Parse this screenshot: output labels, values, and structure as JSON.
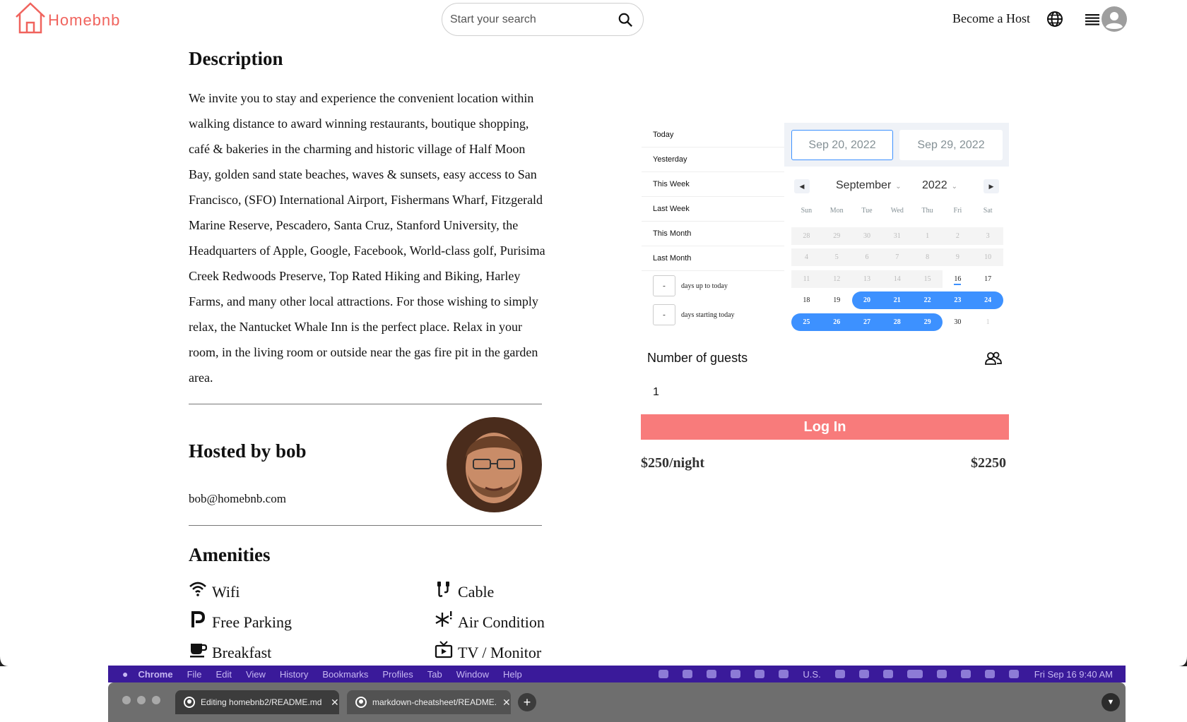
{
  "header": {
    "logo_text": "Homebnb",
    "search_placeholder": "Start your search",
    "become_host": "Become a Host"
  },
  "description": {
    "title": "Description",
    "text": "We invite you to stay and experience the convenient location within walking distance to award winning restaurants, boutique shopping, café & bakeries in the charming and historic village of Half Moon Bay, golden sand state beaches, waves & sunsets, easy access to San Francisco, (SFO) International Airport, Fishermans Wharf, Fitzgerald Marine Reserve, Pescadero, Santa Cruz, Stanford University, the Headquarters of Apple, Google, Facebook, World-class golf, Purisima Creek Redwoods Preserve, Top Rated Hiking and Biking, Harley Farms, and many other local attractions. For those wishing to simply relax, the Nantucket Whale Inn is the perfect place. Relax in your room, in the living room or outside near the gas fire pit in the garden area."
  },
  "host": {
    "title": "Hosted by bob",
    "email": "bob@homebnb.com"
  },
  "amenities": {
    "title": "Amenities",
    "items": [
      {
        "label": "Wifi",
        "icon": "wifi-icon"
      },
      {
        "label": "Cable",
        "icon": "cable-icon"
      },
      {
        "label": "Free Parking",
        "icon": "parking-icon"
      },
      {
        "label": "Air Condition",
        "icon": "snowflake-icon"
      },
      {
        "label": "Breakfast",
        "icon": "coffee-icon"
      },
      {
        "label": "TV / Monitor",
        "icon": "tv-icon"
      }
    ]
  },
  "picker": {
    "ranges": [
      "Today",
      "Yesterday",
      "This Week",
      "Last Week",
      "This Month",
      "Last Month"
    ],
    "input_ranges": [
      {
        "value": "-",
        "label": "days up to today"
      },
      {
        "value": "-",
        "label": "days starting today"
      }
    ],
    "start_date": "Sep 20, 2022",
    "end_date": "Sep 29, 2022",
    "month": "September",
    "year": "2022",
    "weekdays": [
      "Sun",
      "Mon",
      "Tue",
      "Wed",
      "Thu",
      "Fri",
      "Sat"
    ],
    "weeks": [
      [
        {
          "d": "28",
          "s": "dis"
        },
        {
          "d": "29",
          "s": "dis"
        },
        {
          "d": "30",
          "s": "dis"
        },
        {
          "d": "31",
          "s": "dis"
        },
        {
          "d": "1",
          "s": "dis"
        },
        {
          "d": "2",
          "s": "dis"
        },
        {
          "d": "3",
          "s": "dis"
        }
      ],
      [
        {
          "d": "4",
          "s": "dis"
        },
        {
          "d": "5",
          "s": "dis"
        },
        {
          "d": "6",
          "s": "dis"
        },
        {
          "d": "7",
          "s": "dis"
        },
        {
          "d": "8",
          "s": "dis"
        },
        {
          "d": "9",
          "s": "dis"
        },
        {
          "d": "10",
          "s": "dis"
        }
      ],
      [
        {
          "d": "11",
          "s": "dis"
        },
        {
          "d": "12",
          "s": "dis"
        },
        {
          "d": "13",
          "s": "dis"
        },
        {
          "d": "14",
          "s": "dis"
        },
        {
          "d": "15",
          "s": "dis"
        },
        {
          "d": "16",
          "s": "today"
        },
        {
          "d": "17",
          "s": ""
        }
      ],
      [
        {
          "d": "18",
          "s": ""
        },
        {
          "d": "19",
          "s": ""
        },
        {
          "d": "20",
          "s": "sel first"
        },
        {
          "d": "21",
          "s": "sel"
        },
        {
          "d": "22",
          "s": "sel"
        },
        {
          "d": "23",
          "s": "sel"
        },
        {
          "d": "24",
          "s": "sel last"
        }
      ],
      [
        {
          "d": "25",
          "s": "sel first"
        },
        {
          "d": "26",
          "s": "sel"
        },
        {
          "d": "27",
          "s": "sel"
        },
        {
          "d": "28",
          "s": "sel"
        },
        {
          "d": "29",
          "s": "sel last"
        },
        {
          "d": "30",
          "s": ""
        },
        {
          "d": "1",
          "s": "off"
        }
      ]
    ]
  },
  "booking": {
    "guests_label": "Number of guests",
    "guests_value": "1",
    "login_label": "Log In",
    "price_per_night": "$250/night",
    "total": "$2250"
  },
  "menubar": {
    "apple": "",
    "app": "Chrome",
    "items": [
      "File",
      "Edit",
      "View",
      "History",
      "Bookmarks",
      "Profiles",
      "Tab",
      "Window",
      "Help"
    ],
    "keyboard": "U.S.",
    "clock": "Fri Sep 16  9:40 AM"
  },
  "tabs": [
    {
      "title": "Editing homebnb2/README.md",
      "active": true
    },
    {
      "title": "markdown-cheatsheet/README.md",
      "active": false
    }
  ],
  "colors": {
    "brand": "#f0635d",
    "accent_blue": "#3d91ff",
    "login_button": "#f87b7b",
    "menubar": "#3a1a9a"
  }
}
